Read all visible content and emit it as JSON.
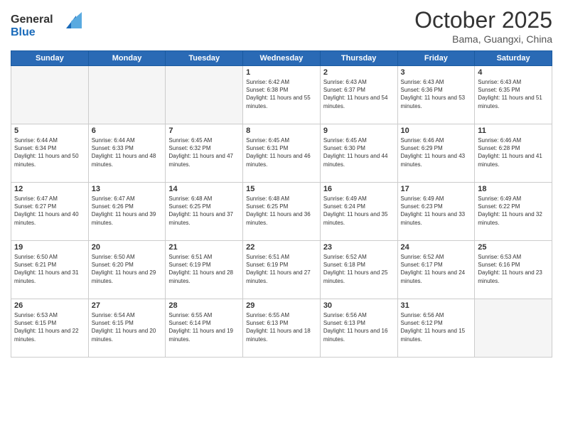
{
  "header": {
    "logo": {
      "line1": "General",
      "line2": "Blue"
    },
    "title": "October 2025",
    "subtitle": "Bama, Guangxi, China"
  },
  "weekdays": [
    "Sunday",
    "Monday",
    "Tuesday",
    "Wednesday",
    "Thursday",
    "Friday",
    "Saturday"
  ],
  "weeks": [
    [
      {
        "day": "",
        "empty": true
      },
      {
        "day": "",
        "empty": true
      },
      {
        "day": "",
        "empty": true
      },
      {
        "day": "1",
        "sunrise": "6:42 AM",
        "sunset": "6:38 PM",
        "daylight": "11 hours and 55 minutes."
      },
      {
        "day": "2",
        "sunrise": "6:43 AM",
        "sunset": "6:37 PM",
        "daylight": "11 hours and 54 minutes."
      },
      {
        "day": "3",
        "sunrise": "6:43 AM",
        "sunset": "6:36 PM",
        "daylight": "11 hours and 53 minutes."
      },
      {
        "day": "4",
        "sunrise": "6:43 AM",
        "sunset": "6:35 PM",
        "daylight": "11 hours and 51 minutes."
      }
    ],
    [
      {
        "day": "5",
        "sunrise": "6:44 AM",
        "sunset": "6:34 PM",
        "daylight": "11 hours and 50 minutes."
      },
      {
        "day": "6",
        "sunrise": "6:44 AM",
        "sunset": "6:33 PM",
        "daylight": "11 hours and 48 minutes."
      },
      {
        "day": "7",
        "sunrise": "6:45 AM",
        "sunset": "6:32 PM",
        "daylight": "11 hours and 47 minutes."
      },
      {
        "day": "8",
        "sunrise": "6:45 AM",
        "sunset": "6:31 PM",
        "daylight": "11 hours and 46 minutes."
      },
      {
        "day": "9",
        "sunrise": "6:45 AM",
        "sunset": "6:30 PM",
        "daylight": "11 hours and 44 minutes."
      },
      {
        "day": "10",
        "sunrise": "6:46 AM",
        "sunset": "6:29 PM",
        "daylight": "11 hours and 43 minutes."
      },
      {
        "day": "11",
        "sunrise": "6:46 AM",
        "sunset": "6:28 PM",
        "daylight": "11 hours and 41 minutes."
      }
    ],
    [
      {
        "day": "12",
        "sunrise": "6:47 AM",
        "sunset": "6:27 PM",
        "daylight": "11 hours and 40 minutes."
      },
      {
        "day": "13",
        "sunrise": "6:47 AM",
        "sunset": "6:26 PM",
        "daylight": "11 hours and 39 minutes."
      },
      {
        "day": "14",
        "sunrise": "6:48 AM",
        "sunset": "6:25 PM",
        "daylight": "11 hours and 37 minutes."
      },
      {
        "day": "15",
        "sunrise": "6:48 AM",
        "sunset": "6:25 PM",
        "daylight": "11 hours and 36 minutes."
      },
      {
        "day": "16",
        "sunrise": "6:49 AM",
        "sunset": "6:24 PM",
        "daylight": "11 hours and 35 minutes."
      },
      {
        "day": "17",
        "sunrise": "6:49 AM",
        "sunset": "6:23 PM",
        "daylight": "11 hours and 33 minutes."
      },
      {
        "day": "18",
        "sunrise": "6:49 AM",
        "sunset": "6:22 PM",
        "daylight": "11 hours and 32 minutes."
      }
    ],
    [
      {
        "day": "19",
        "sunrise": "6:50 AM",
        "sunset": "6:21 PM",
        "daylight": "11 hours and 31 minutes."
      },
      {
        "day": "20",
        "sunrise": "6:50 AM",
        "sunset": "6:20 PM",
        "daylight": "11 hours and 29 minutes."
      },
      {
        "day": "21",
        "sunrise": "6:51 AM",
        "sunset": "6:19 PM",
        "daylight": "11 hours and 28 minutes."
      },
      {
        "day": "22",
        "sunrise": "6:51 AM",
        "sunset": "6:19 PM",
        "daylight": "11 hours and 27 minutes."
      },
      {
        "day": "23",
        "sunrise": "6:52 AM",
        "sunset": "6:18 PM",
        "daylight": "11 hours and 25 minutes."
      },
      {
        "day": "24",
        "sunrise": "6:52 AM",
        "sunset": "6:17 PM",
        "daylight": "11 hours and 24 minutes."
      },
      {
        "day": "25",
        "sunrise": "6:53 AM",
        "sunset": "6:16 PM",
        "daylight": "11 hours and 23 minutes."
      }
    ],
    [
      {
        "day": "26",
        "sunrise": "6:53 AM",
        "sunset": "6:15 PM",
        "daylight": "11 hours and 22 minutes."
      },
      {
        "day": "27",
        "sunrise": "6:54 AM",
        "sunset": "6:15 PM",
        "daylight": "11 hours and 20 minutes."
      },
      {
        "day": "28",
        "sunrise": "6:55 AM",
        "sunset": "6:14 PM",
        "daylight": "11 hours and 19 minutes."
      },
      {
        "day": "29",
        "sunrise": "6:55 AM",
        "sunset": "6:13 PM",
        "daylight": "11 hours and 18 minutes."
      },
      {
        "day": "30",
        "sunrise": "6:56 AM",
        "sunset": "6:13 PM",
        "daylight": "11 hours and 16 minutes."
      },
      {
        "day": "31",
        "sunrise": "6:56 AM",
        "sunset": "6:12 PM",
        "daylight": "11 hours and 15 minutes."
      },
      {
        "day": "",
        "empty": true
      }
    ]
  ]
}
